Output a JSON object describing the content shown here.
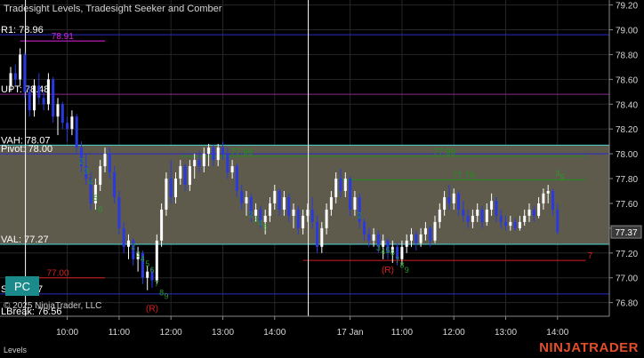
{
  "window": {
    "title": "Tradesight Levels, Tradesight Seeker and Comber",
    "copyright": "© 2025 NinjaTrader, LLC",
    "panel_label": "Levels",
    "brand": "NINJATRADER",
    "pc_button_label": "PC"
  },
  "colors": {
    "background": "#000000",
    "grid": "#262626",
    "value_area_fill": "#5e5a4c",
    "teal_line": "#4fd6d6",
    "blue_line": "#2b2bc8",
    "purple_line": "#8a2a8a",
    "red_line": "#d42020",
    "green_line": "#1f8f1f",
    "candle_up": "#ffffff",
    "candle_down": "#2a3ae0",
    "seeker_green": "#2a9a2a",
    "reversal_red": "#e02020",
    "magenta_label": "#e020e0"
  },
  "chart_data": {
    "type": "candlestick",
    "ylim": [
      76.69,
      79.24
    ],
    "y_ticks": [
      76.8,
      77.0,
      77.2,
      77.4,
      77.6,
      77.8,
      78.0,
      78.2,
      78.4,
      78.6,
      78.8,
      79.0,
      79.2
    ],
    "y_tick_labels": [
      "76.80",
      "77.00",
      "77.20",
      "77.40",
      "77.60",
      "77.80",
      "78.00",
      "78.20",
      "78.40",
      "78.60",
      "78.80",
      "79.00",
      "79.20"
    ],
    "x_ticks": [
      {
        "bar": 12,
        "label": "10:00"
      },
      {
        "bar": 23,
        "label": "11:00"
      },
      {
        "bar": 34,
        "label": "12:00"
      },
      {
        "bar": 45,
        "label": "13:00"
      },
      {
        "bar": 56,
        "label": "14:00"
      },
      {
        "bar": 72,
        "label": "17 Jan"
      },
      {
        "bar": 83,
        "label": "11:00"
      },
      {
        "bar": 94,
        "label": "12:00"
      },
      {
        "bar": 105,
        "label": "13:00"
      },
      {
        "bar": 116,
        "label": "14:00"
      }
    ],
    "current_price": {
      "value": 77.37,
      "label": "77.37"
    },
    "session_break_bars": [
      2,
      62
    ],
    "value_area": {
      "low": 77.27,
      "high": 78.07
    },
    "levels": [
      {
        "name": "R1",
        "label": "R1: 78.96",
        "value": 78.96,
        "color": "#2b2bc8"
      },
      {
        "name": "UPT",
        "label": "UPT: 78.48",
        "value": 78.48,
        "color": "#8a2a8a"
      },
      {
        "name": "VAH",
        "label": "VAH: 78.07",
        "value": 78.07,
        "color": "#4fd6d6"
      },
      {
        "name": "Pivot",
        "label": "Pivot: 78.00",
        "value": 78.0,
        "color": "#2b2bc8"
      },
      {
        "name": "VAL",
        "label": "VAL: 77.27",
        "value": 77.27,
        "color": "#4fd6d6"
      },
      {
        "name": "S1",
        "label": "S1: 76.87",
        "value": 76.87,
        "color": "#2b2bc8"
      },
      {
        "name": "LBreak",
        "label": "LBreak: 76.56",
        "value": 76.56,
        "color": "#2b2bc8"
      }
    ],
    "segments": [
      {
        "name": "magenta-level",
        "value": 78.91,
        "label": "78.91",
        "from_bar": 2,
        "to_bar": 20,
        "color": "#e020e0"
      },
      {
        "name": "red-level-left",
        "value": 77.0,
        "label": "77.00",
        "from_bar": 0,
        "to_bar": 20,
        "color": "#d42020"
      },
      {
        "name": "red-level-right",
        "value": 77.14,
        "label": "7",
        "from_bar": 62,
        "to_bar": 122,
        "color": "#d42020"
      },
      {
        "name": "green-level-left",
        "value": 77.98,
        "label": "77.98",
        "from_bar": 36,
        "to_bar": 62,
        "color": "#1f8f1f"
      },
      {
        "name": "green-level-mid",
        "value": 77.98,
        "label": "77.98",
        "from_bar": 62,
        "to_bar": 122,
        "color": "#1f8f1f"
      },
      {
        "name": "green-level-right",
        "value": 77.79,
        "label": "77.79",
        "from_bar": 70,
        "to_bar": 122,
        "color": "#1f8f1f"
      }
    ],
    "seeker_labels": [
      {
        "bar": 15,
        "value": 77.92,
        "text": "2"
      },
      {
        "bar": 16,
        "value": 77.84,
        "text": "3"
      },
      {
        "bar": 17,
        "value": 77.75,
        "text": "4"
      },
      {
        "bar": 18,
        "value": 77.62,
        "text": "5"
      },
      {
        "bar": 19,
        "value": 77.53,
        "text": "6"
      },
      {
        "bar": 26,
        "value": 77.23,
        "text": "2"
      },
      {
        "bar": 27,
        "value": 77.17,
        "text": "3"
      },
      {
        "bar": 28,
        "value": 77.13,
        "text": "4"
      },
      {
        "bar": 29,
        "value": 77.09,
        "text": "5"
      },
      {
        "bar": 30,
        "value": 77.04,
        "text": "6"
      },
      {
        "bar": 31,
        "value": 76.93,
        "text": "7"
      },
      {
        "bar": 32,
        "value": 76.86,
        "text": "8"
      },
      {
        "bar": 33,
        "value": 76.83,
        "text": "9"
      },
      {
        "bar": 51,
        "value": 77.49,
        "text": "2"
      },
      {
        "bar": 52,
        "value": 77.45,
        "text": "3"
      },
      {
        "bar": 53,
        "value": 77.42,
        "text": "4"
      },
      {
        "bar": 54,
        "value": 77.39,
        "text": "5"
      },
      {
        "bar": 74,
        "value": 77.48,
        "text": "2"
      },
      {
        "bar": 78,
        "value": 77.22,
        "text": "3"
      },
      {
        "bar": 79,
        "value": 77.19,
        "text": "4"
      },
      {
        "bar": 80,
        "value": 77.2,
        "text": "5"
      },
      {
        "bar": 81,
        "value": 77.18,
        "text": "6"
      },
      {
        "bar": 82,
        "value": 77.12,
        "text": "7"
      },
      {
        "bar": 83,
        "value": 77.08,
        "text": "8"
      },
      {
        "bar": 84,
        "value": 77.04,
        "text": "9"
      },
      {
        "bar": 116,
        "value": 77.82,
        "text": "3"
      },
      {
        "bar": 117,
        "value": 77.79,
        "text": "5"
      }
    ],
    "reversal_labels": [
      {
        "bar": 30,
        "value": 76.73,
        "text": "(R)"
      },
      {
        "bar": 80,
        "value": 77.04,
        "text": "(R)"
      }
    ],
    "candles": [
      [
        78.55,
        78.7,
        78.5,
        78.65
      ],
      [
        78.65,
        78.72,
        78.55,
        78.6
      ],
      [
        78.6,
        78.85,
        78.55,
        78.8
      ],
      [
        78.8,
        78.82,
        78.45,
        78.5
      ],
      [
        78.5,
        78.55,
        78.3,
        78.35
      ],
      [
        78.35,
        78.6,
        78.3,
        78.55
      ],
      [
        78.55,
        78.65,
        78.4,
        78.45
      ],
      [
        78.45,
        78.5,
        78.35,
        78.4
      ],
      [
        78.4,
        78.65,
        78.35,
        78.6
      ],
      [
        78.6,
        78.62,
        78.25,
        78.3
      ],
      [
        78.3,
        78.45,
        78.15,
        78.4
      ],
      [
        78.4,
        78.42,
        78.2,
        78.25
      ],
      [
        78.25,
        78.3,
        78.1,
        78.2
      ],
      [
        78.2,
        78.35,
        78.15,
        78.3
      ],
      [
        78.3,
        78.32,
        78.0,
        78.05
      ],
      [
        78.05,
        78.1,
        77.85,
        77.9
      ],
      [
        77.9,
        78.0,
        77.75,
        77.8
      ],
      [
        77.8,
        77.85,
        77.55,
        77.6
      ],
      [
        77.6,
        77.8,
        77.55,
        77.75
      ],
      [
        77.75,
        77.95,
        77.7,
        77.9
      ],
      [
        77.9,
        78.05,
        77.85,
        78.0
      ],
      [
        78.0,
        78.05,
        77.8,
        77.85
      ],
      [
        77.85,
        77.9,
        77.6,
        77.65
      ],
      [
        77.65,
        77.7,
        77.35,
        77.4
      ],
      [
        77.4,
        77.45,
        77.2,
        77.25
      ],
      [
        77.25,
        77.35,
        77.15,
        77.3
      ],
      [
        77.3,
        77.32,
        77.1,
        77.15
      ],
      [
        77.15,
        77.25,
        77.05,
        77.2
      ],
      [
        77.2,
        77.22,
        76.95,
        77.0
      ],
      [
        77.0,
        77.1,
        76.9,
        77.05
      ],
      [
        77.05,
        77.08,
        76.92,
        76.98
      ],
      [
        76.98,
        77.35,
        76.95,
        77.3
      ],
      [
        77.3,
        77.6,
        77.25,
        77.55
      ],
      [
        77.55,
        77.85,
        77.5,
        77.8
      ],
      [
        77.8,
        77.95,
        77.6,
        77.65
      ],
      [
        77.65,
        77.85,
        77.6,
        77.8
      ],
      [
        77.8,
        77.95,
        77.75,
        77.9
      ],
      [
        77.9,
        77.92,
        77.7,
        77.75
      ],
      [
        77.75,
        77.95,
        77.7,
        77.9
      ],
      [
        77.9,
        78.0,
        77.8,
        77.95
      ],
      [
        77.95,
        78.02,
        77.85,
        77.9
      ],
      [
        77.9,
        78.05,
        77.85,
        78.0
      ],
      [
        78.0,
        78.08,
        77.9,
        78.05
      ],
      [
        78.05,
        78.07,
        77.9,
        77.95
      ],
      [
        77.95,
        78.08,
        77.9,
        78.05
      ],
      [
        78.05,
        78.1,
        77.95,
        78.0
      ],
      [
        78.0,
        78.05,
        77.8,
        77.85
      ],
      [
        77.85,
        77.95,
        77.8,
        77.9
      ],
      [
        77.9,
        77.92,
        77.65,
        77.7
      ],
      [
        77.7,
        77.75,
        77.55,
        77.6
      ],
      [
        77.6,
        77.7,
        77.5,
        77.65
      ],
      [
        77.65,
        77.68,
        77.45,
        77.5
      ],
      [
        77.5,
        77.6,
        77.45,
        77.55
      ],
      [
        77.55,
        77.58,
        77.4,
        77.45
      ],
      [
        77.45,
        77.55,
        77.35,
        77.5
      ],
      [
        77.5,
        77.65,
        77.45,
        77.6
      ],
      [
        77.6,
        77.75,
        77.55,
        77.7
      ],
      [
        77.7,
        77.72,
        77.5,
        77.55
      ],
      [
        77.55,
        77.7,
        77.5,
        77.65
      ],
      [
        77.65,
        77.68,
        77.45,
        77.5
      ],
      [
        77.5,
        77.6,
        77.4,
        77.55
      ],
      [
        77.55,
        77.58,
        77.35,
        77.4
      ],
      [
        77.4,
        77.55,
        77.35,
        77.5
      ],
      [
        77.5,
        77.6,
        77.45,
        77.55
      ],
      [
        77.55,
        77.65,
        77.4,
        77.45
      ],
      [
        77.45,
        77.5,
        77.2,
        77.25
      ],
      [
        77.25,
        77.45,
        77.2,
        77.4
      ],
      [
        77.4,
        77.6,
        77.35,
        77.55
      ],
      [
        77.55,
        77.7,
        77.5,
        77.65
      ],
      [
        77.65,
        77.85,
        77.6,
        77.8
      ],
      [
        77.8,
        77.88,
        77.65,
        77.7
      ],
      [
        77.7,
        77.85,
        77.65,
        77.8
      ],
      [
        77.8,
        77.82,
        77.5,
        77.55
      ],
      [
        77.55,
        77.7,
        77.5,
        77.65
      ],
      [
        77.65,
        77.68,
        77.4,
        77.45
      ],
      [
        77.45,
        77.48,
        77.3,
        77.35
      ],
      [
        77.35,
        77.4,
        77.25,
        77.3
      ],
      [
        77.3,
        77.4,
        77.25,
        77.35
      ],
      [
        77.35,
        77.38,
        77.2,
        77.25
      ],
      [
        77.25,
        77.35,
        77.15,
        77.3
      ],
      [
        77.3,
        77.32,
        77.15,
        77.2
      ],
      [
        77.2,
        77.3,
        77.12,
        77.25
      ],
      [
        77.25,
        77.28,
        77.1,
        77.15
      ],
      [
        77.15,
        77.3,
        77.1,
        77.25
      ],
      [
        77.25,
        77.35,
        77.2,
        77.3
      ],
      [
        77.3,
        77.4,
        77.25,
        77.35
      ],
      [
        77.35,
        77.38,
        77.22,
        77.28
      ],
      [
        77.28,
        77.4,
        77.25,
        77.35
      ],
      [
        77.35,
        77.45,
        77.3,
        77.4
      ],
      [
        77.4,
        77.42,
        77.25,
        77.3
      ],
      [
        77.3,
        77.5,
        77.28,
        77.45
      ],
      [
        77.45,
        77.6,
        77.4,
        77.55
      ],
      [
        77.55,
        77.7,
        77.5,
        77.65
      ],
      [
        77.65,
        77.75,
        77.55,
        77.6
      ],
      [
        77.6,
        77.72,
        77.55,
        77.68
      ],
      [
        77.68,
        77.7,
        77.5,
        77.55
      ],
      [
        77.55,
        77.62,
        77.45,
        77.5
      ],
      [
        77.5,
        77.55,
        77.4,
        77.45
      ],
      [
        77.45,
        77.55,
        77.4,
        77.5
      ],
      [
        77.5,
        77.6,
        77.45,
        77.55
      ],
      [
        77.55,
        77.58,
        77.4,
        77.45
      ],
      [
        77.45,
        77.6,
        77.42,
        77.55
      ],
      [
        77.55,
        77.68,
        77.5,
        77.62
      ],
      [
        77.62,
        77.65,
        77.45,
        77.5
      ],
      [
        77.5,
        77.55,
        77.4,
        77.45
      ],
      [
        77.45,
        77.5,
        77.38,
        77.42
      ],
      [
        77.42,
        77.5,
        77.38,
        77.45
      ],
      [
        77.45,
        77.48,
        77.38,
        77.4
      ],
      [
        77.4,
        77.5,
        77.38,
        77.45
      ],
      [
        77.45,
        77.55,
        77.42,
        77.5
      ],
      [
        77.5,
        77.6,
        77.45,
        77.55
      ],
      [
        77.55,
        77.58,
        77.45,
        77.5
      ],
      [
        77.5,
        77.65,
        77.48,
        77.6
      ],
      [
        77.6,
        77.72,
        77.55,
        77.68
      ],
      [
        77.68,
        77.75,
        77.6,
        77.7
      ],
      [
        77.7,
        77.72,
        77.5,
        77.55
      ],
      [
        77.55,
        77.6,
        77.35,
        77.37
      ]
    ]
  }
}
